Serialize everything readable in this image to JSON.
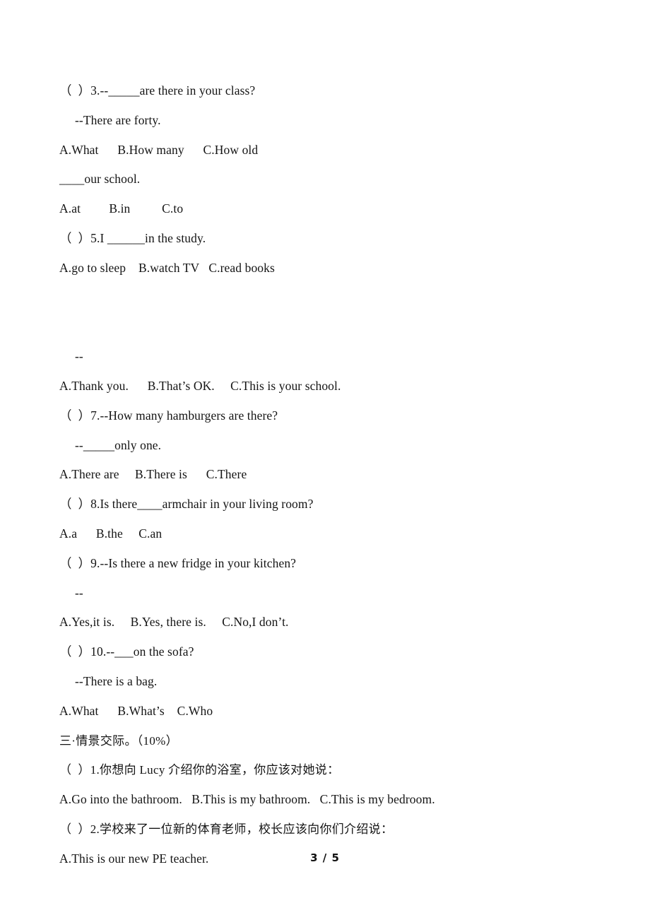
{
  "document": {
    "page_footer": "3 / 5",
    "lines": [
      {
        "id": "q3-stem",
        "text": "（  ）3.--_____are there in your class?",
        "style": "normal"
      },
      {
        "id": "q3-reply",
        "text": "--There are forty.",
        "style": "indent"
      },
      {
        "id": "q3-options",
        "text": "A.What      B.How many      C.How old",
        "style": "normal"
      },
      {
        "id": "q4-stem",
        "text": "____our school.",
        "style": "normal"
      },
      {
        "id": "q4-options",
        "text": "A.at         B.in          C.to",
        "style": "normal"
      },
      {
        "id": "q5-stem",
        "text": "（  ）5.I ______in the study.",
        "style": "normal"
      },
      {
        "id": "q5-options",
        "text": "A.go to sleep    B.watch TV   C.read books",
        "style": "normal"
      },
      {
        "id": "q6-blank-gap",
        "text": " ",
        "style": "blank"
      },
      {
        "id": "q6-stem",
        "text": " ",
        "style": "blank"
      },
      {
        "id": "q6-reply",
        "text": "--",
        "style": "indent"
      },
      {
        "id": "q6-options",
        "text": "A.Thank you.      B.That’s OK.     C.This is your school.",
        "style": "normal"
      },
      {
        "id": "q7-stem",
        "text": "（  ）7.--How many hamburgers are there?",
        "style": "normal"
      },
      {
        "id": "q7-reply",
        "text": "--_____only one.",
        "style": "indent"
      },
      {
        "id": "q7-options",
        "text": "A.There are     B.There is      C.There",
        "style": "normal"
      },
      {
        "id": "q8-stem",
        "text": "（  ）8.Is there____armchair in your living room?",
        "style": "normal"
      },
      {
        "id": "q8-options",
        "text": "A.a      B.the     C.an",
        "style": "normal"
      },
      {
        "id": "q9-stem",
        "text": "（  ）9.--Is there a new fridge in your kitchen?",
        "style": "normal"
      },
      {
        "id": "q9-reply",
        "text": "--",
        "style": "indent"
      },
      {
        "id": "q9-options",
        "text": "A.Yes,it is.     B.Yes, there is.     C.No,I don’t.",
        "style": "normal"
      },
      {
        "id": "q10-stem",
        "text": "（  ）10.--___on the sofa?",
        "style": "normal"
      },
      {
        "id": "q10-reply",
        "text": "--There is a bag.",
        "style": "indent"
      },
      {
        "id": "q10-options",
        "text": "A.What      B.What’s    C.Who",
        "style": "normal"
      },
      {
        "id": "section3-head",
        "text": "三·情景交际。（10%）",
        "style": "cn"
      },
      {
        "id": "s3q1-stem",
        "text": "（  ）1.你想向 Lucy 介绍你的浴室，你应该对她说：",
        "style": "cn"
      },
      {
        "id": "s3q1-options",
        "text": "A.Go into the bathroom.   B.This is my bathroom.   C.This is my bedroom.",
        "style": "normal"
      },
      {
        "id": "s3q2-stem",
        "text": "（  ）2.学校来了一位新的体育老师，校长应该向你们介绍说：",
        "style": "cn"
      },
      {
        "id": "s3q2-optionA",
        "text": "A.This is our new PE teacher.",
        "style": "normal"
      }
    ]
  }
}
